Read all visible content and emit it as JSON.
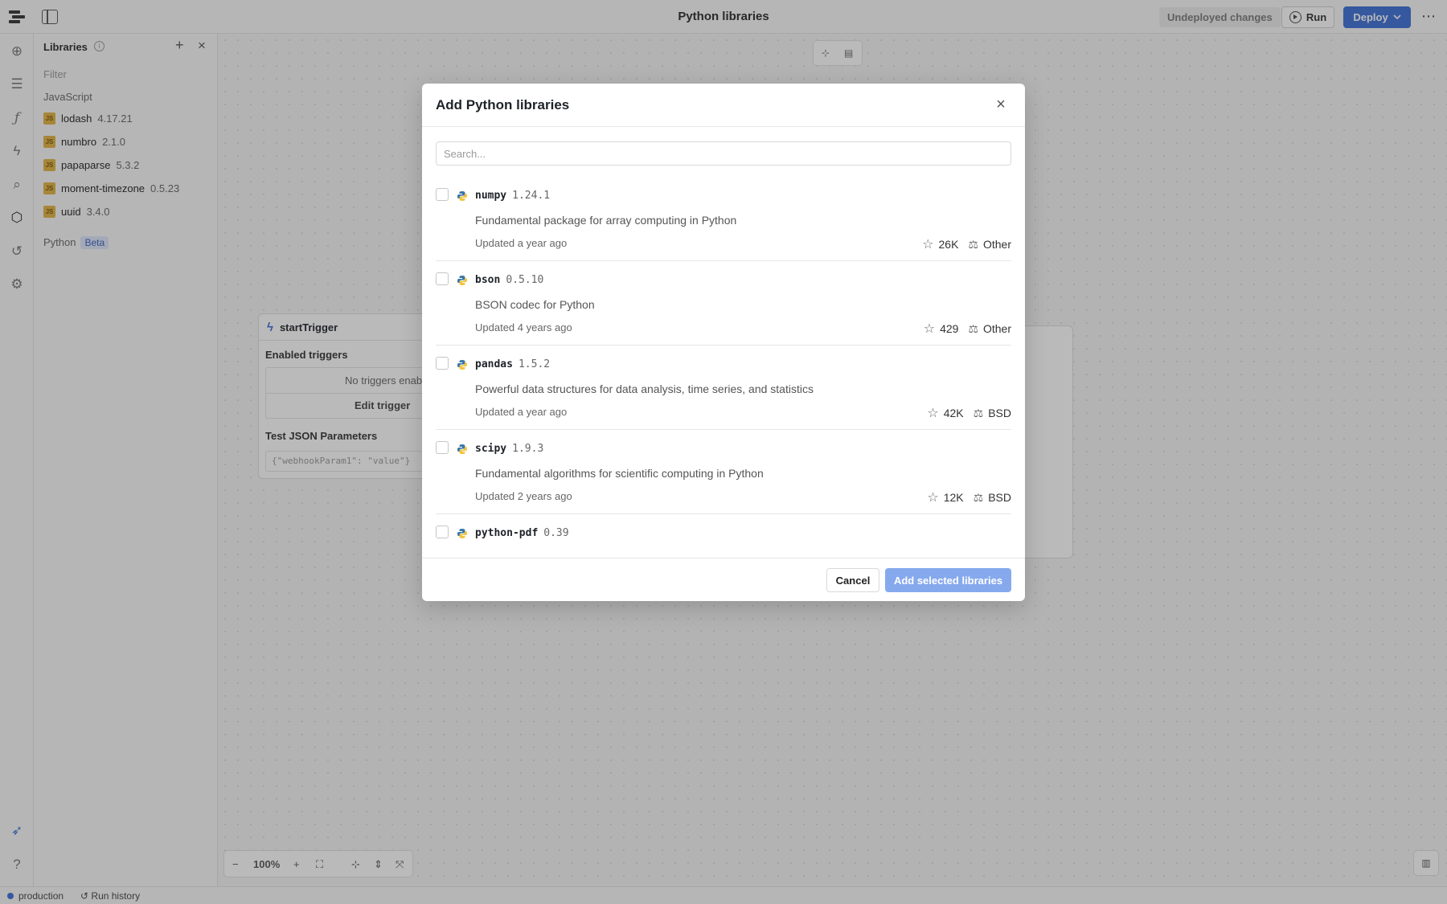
{
  "topbar": {
    "title": "Python libraries",
    "undeployed": "Undeployed changes",
    "run_label": "Run",
    "deploy_label": "Deploy",
    "more": "⋯"
  },
  "sidebar": {
    "title": "Libraries",
    "filter_placeholder": "Filter",
    "javascript_label": "JavaScript",
    "js_badge": "JS",
    "js_libraries": [
      {
        "name": "lodash",
        "version": "4.17.21"
      },
      {
        "name": "numbro",
        "version": "2.1.0"
      },
      {
        "name": "papaparse",
        "version": "5.3.2"
      },
      {
        "name": "moment-timezone",
        "version": "0.5.23"
      },
      {
        "name": "uuid",
        "version": "3.4.0"
      }
    ],
    "python_label": "Python",
    "python_badge": "Beta"
  },
  "canvas": {
    "node_title": "startTrigger",
    "enabled_triggers": "Enabled triggers",
    "no_triggers": "No triggers enab",
    "edit_triggers": "Edit trigger",
    "test_json_label": "Test JSON Parameters",
    "test_json_value": "{\"webhookParam1\": \"value\"}",
    "zoom": "100%"
  },
  "statusbar": {
    "environment": "production",
    "run_history": "Run history"
  },
  "modal": {
    "title": "Add Python libraries",
    "search_placeholder": "Search...",
    "packages": [
      {
        "name": "numpy",
        "version": "1.24.1",
        "description": "Fundamental package for array computing in Python",
        "updated": "Updated a year ago",
        "stars": "26K",
        "license": "Other"
      },
      {
        "name": "bson",
        "version": "0.5.10",
        "description": "BSON codec for Python",
        "updated": "Updated 4 years ago",
        "stars": "429",
        "license": "Other"
      },
      {
        "name": "pandas",
        "version": "1.5.2",
        "description": "Powerful data structures for data analysis, time series, and statistics",
        "updated": "Updated a year ago",
        "stars": "42K",
        "license": "BSD"
      },
      {
        "name": "scipy",
        "version": "1.9.3",
        "description": "Fundamental algorithms for scientific computing in Python",
        "updated": "Updated 2 years ago",
        "stars": "12K",
        "license": "BSD"
      },
      {
        "name": "python-pdf",
        "version": "0.39"
      }
    ],
    "cancel_label": "Cancel",
    "add_label": "Add selected libraries"
  },
  "colors": {
    "accent": "#3b6fd8",
    "add_button_disabled": "#86a9ee",
    "js_badge": "#e3b341"
  }
}
